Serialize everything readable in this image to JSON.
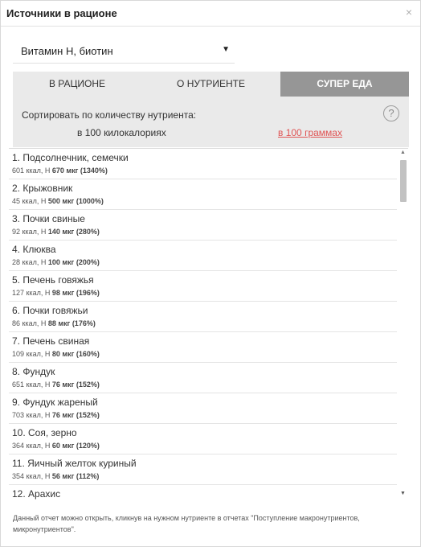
{
  "dialog": {
    "title": "Источники в рационе",
    "close_symbol": "×"
  },
  "nutrient_select": {
    "value": "Витамин H, биотин",
    "arrow": "▼"
  },
  "tabs": [
    {
      "label": "В РАЦИОНЕ",
      "active": false
    },
    {
      "label": "О НУТРИЕНТЕ",
      "active": false
    },
    {
      "label": "СУПЕР ЕДА",
      "active": true
    }
  ],
  "sort": {
    "label": "Сортировать по количеству нутриента:",
    "option_kcal": "в 100 килокалориях",
    "option_grams": "в 100 граммах",
    "help": "?"
  },
  "items": [
    {
      "name": "1. Подсолнечник, семечки",
      "kcal": "601 ккал",
      "nutrient": "H",
      "amount": "670 мкг",
      "percent": "(1340%)"
    },
    {
      "name": "2. Крыжовник",
      "kcal": "45 ккал",
      "nutrient": "H",
      "amount": "500 мкг",
      "percent": "(1000%)"
    },
    {
      "name": "3. Почки свиные",
      "kcal": "92 ккал",
      "nutrient": "H",
      "amount": "140 мкг",
      "percent": "(280%)"
    },
    {
      "name": "4. Клюква",
      "kcal": "28 ккал",
      "nutrient": "H",
      "amount": "100 мкг",
      "percent": "(200%)"
    },
    {
      "name": "5. Печень говяжья",
      "kcal": "127 ккал",
      "nutrient": "H",
      "amount": "98 мкг",
      "percent": "(196%)"
    },
    {
      "name": "6. Почки говяжьи",
      "kcal": "86 ккал",
      "nutrient": "H",
      "amount": "88 мкг",
      "percent": "(176%)"
    },
    {
      "name": "7. Печень свиная",
      "kcal": "109 ккал",
      "nutrient": "H",
      "amount": "80 мкг",
      "percent": "(160%)"
    },
    {
      "name": "8. Фундук",
      "kcal": "651 ккал",
      "nutrient": "H",
      "amount": "76 мкг",
      "percent": "(152%)"
    },
    {
      "name": "9. Фундук жареный",
      "kcal": "703 ккал",
      "nutrient": "H",
      "amount": "76 мкг",
      "percent": "(152%)"
    },
    {
      "name": "10. Соя, зерно",
      "kcal": "364 ккал",
      "nutrient": "H",
      "amount": "60 мкг",
      "percent": "(120%)"
    },
    {
      "name": "11. Яичный желток куриный",
      "kcal": "354 ккал",
      "nutrient": "H",
      "amount": "56 мкг",
      "percent": "(112%)"
    },
    {
      "name": "12. Арахис",
      "kcal": "",
      "nutrient": "",
      "amount": "",
      "percent": ""
    }
  ],
  "scrollbar": {
    "up_arrow": "▲",
    "down_arrow": "▼"
  },
  "footer": {
    "text": "Данный отчет можно открыть, кликнув на нужном нутриенте в отчетах \"Поступление макронутриентов, микронутриентов\"."
  }
}
